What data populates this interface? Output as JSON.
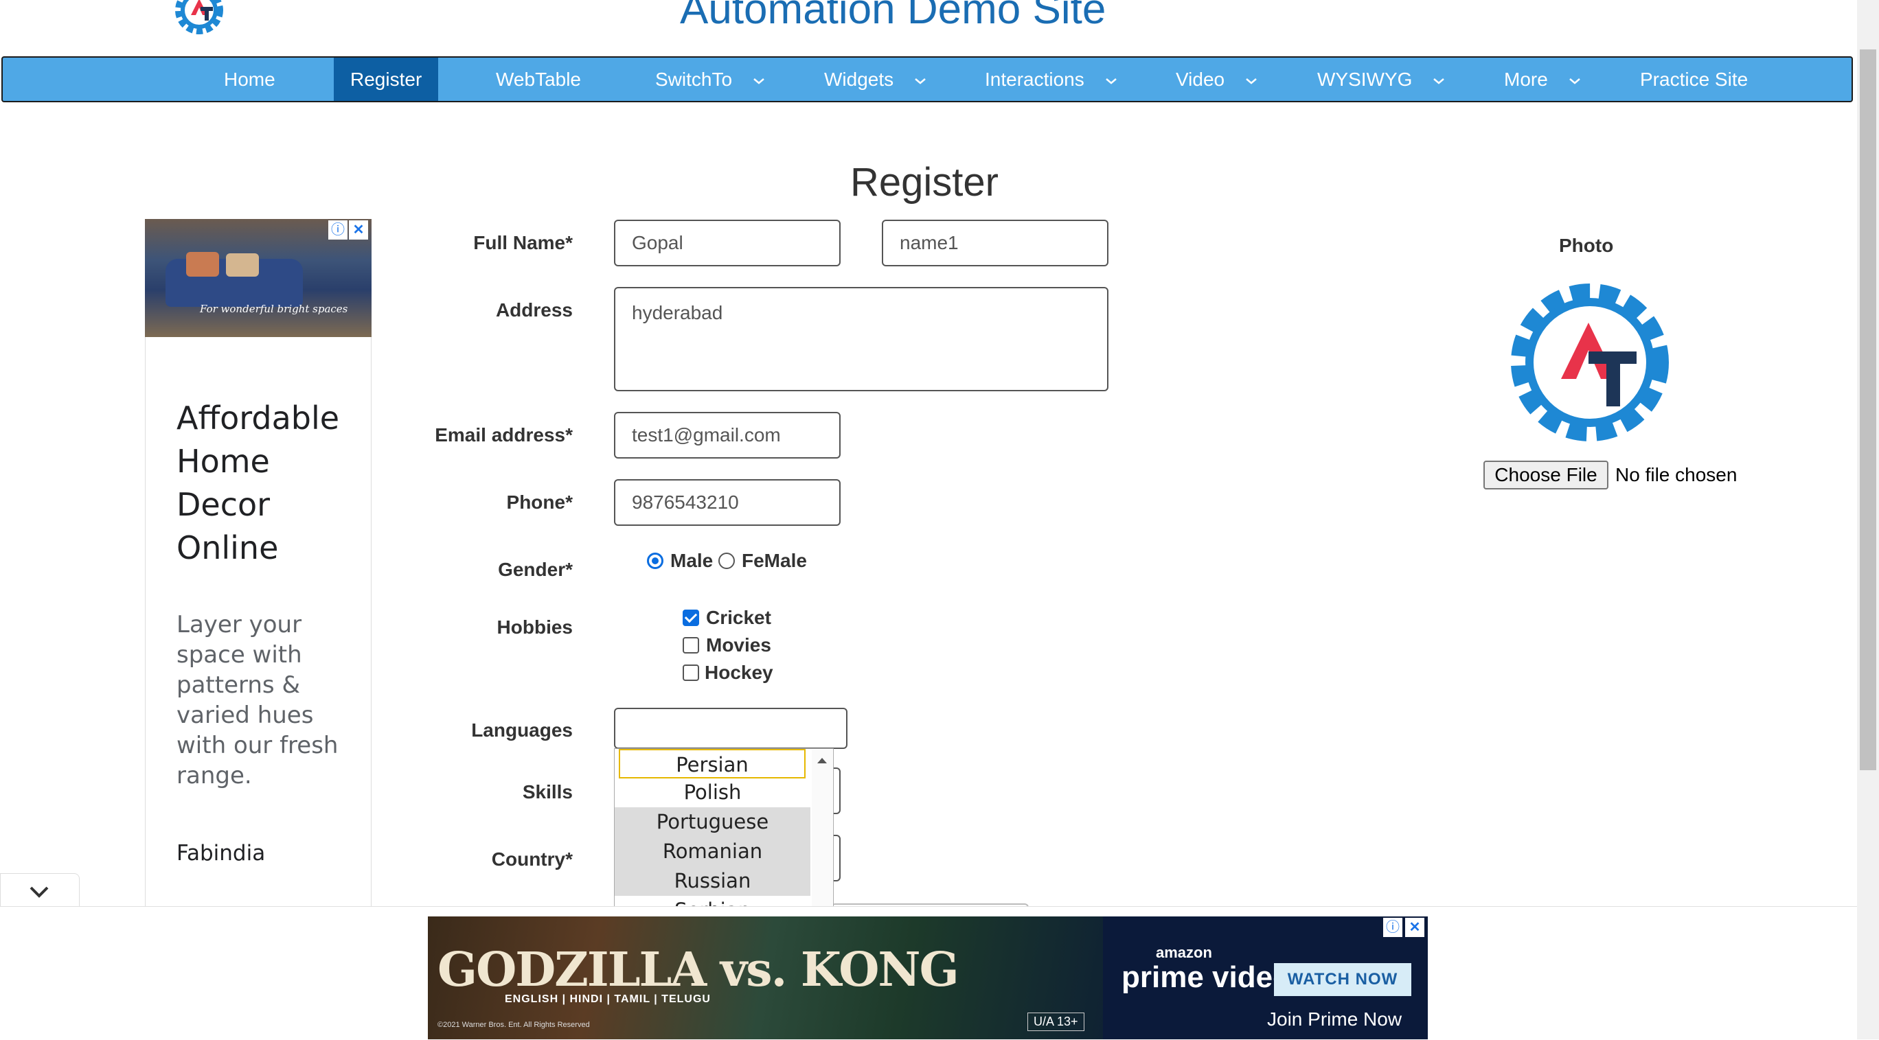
{
  "site": {
    "title": "Automation Demo Site"
  },
  "nav": {
    "items": [
      {
        "label": "Home"
      },
      {
        "label": "Register"
      },
      {
        "label": "WebTable"
      },
      {
        "label": "SwitchTo"
      },
      {
        "label": "Widgets"
      },
      {
        "label": "Interactions"
      },
      {
        "label": "Video"
      },
      {
        "label": "WYSIWYG"
      },
      {
        "label": "More"
      },
      {
        "label": "Practice Site"
      }
    ],
    "active": "Register"
  },
  "page": {
    "title": "Register"
  },
  "form": {
    "full_name_label": "Full Name*",
    "first_name_value": "Gopal",
    "last_name_value": "name1",
    "address_label": "Address",
    "address_value": "hyderabad",
    "email_label": "Email address*",
    "email_value": "test1@gmail.com",
    "phone_label": "Phone*",
    "phone_value": "9876543210",
    "gender_label": "Gender*",
    "gender_options": [
      "Male",
      "FeMale"
    ],
    "gender_selected": "Male",
    "hobbies_label": "Hobbies",
    "hobbies": [
      {
        "label": "Cricket",
        "checked": true
      },
      {
        "label": "Movies",
        "checked": false
      },
      {
        "label": "Hockey",
        "checked": false
      }
    ],
    "languages_label": "Languages",
    "languages_value": "",
    "languages_dropdown": [
      "Persian",
      "Polish",
      "Portuguese",
      "Romanian",
      "Russian",
      "Serbian"
    ],
    "skills_label": "Skills",
    "country_label": "Country*"
  },
  "photo": {
    "label": "Photo",
    "button_label": "Choose File",
    "status": "No file chosen"
  },
  "ads": {
    "left": {
      "caption": "For wonderful bright spaces",
      "heading": "Affordable Home Decor Online",
      "body": "Layer your space with patterns & varied hues with our fresh range.",
      "brand": "Fabindia"
    },
    "bottom": {
      "movie_title": "GODZILLA vs. KONG",
      "languages": "ENGLISH | HINDI | TAMIL | TELUGU",
      "copyright": "©2021 Warner Bros. Ent. All Rights Reserved",
      "rating": "U/A 13+",
      "brand_top": "amazon",
      "brand_main": "prime video",
      "cta": "WATCH NOW",
      "join_text": "Join Prime Now"
    }
  },
  "colors": {
    "nav_bg": "#4fa8e6",
    "nav_active": "#0d5fa3",
    "title": "#1a6db3",
    "logo_blue": "#1e88d4",
    "logo_red": "#e8334a",
    "logo_navy": "#1d3557"
  }
}
